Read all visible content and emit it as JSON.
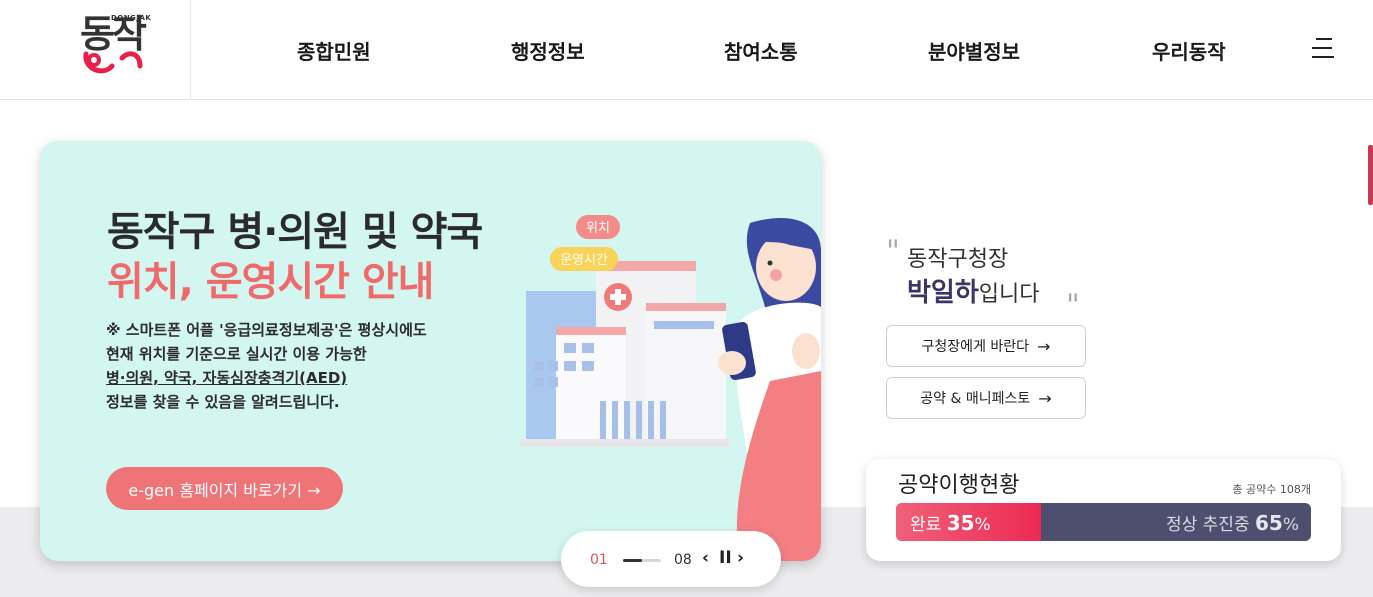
{
  "header": {
    "logo_sub": "DONGJAK",
    "logo_main": "동작",
    "nav": [
      "종합민원",
      "행정정보",
      "참여소통",
      "분야별정보",
      "우리동작"
    ]
  },
  "banner": {
    "title_line1": "동작구 병·의원 및 약국",
    "title_line2": "위치, 운영시간 안내",
    "desc": {
      "l1_prefix": "※ 스마트폰 어플 ",
      "l1_highlight": "'응급의료정보제공'",
      "l1_suffix": "은 평상시에도",
      "l2": "현재 위치를 기준으로 실시간 이용 가능한",
      "l3": "병·의원, 약국, 자동심장충격기(AED)",
      "l4": "정보를 찾을 수 있음을 알려드립니다."
    },
    "button": "e-gen 홈페이지 바로가기 →",
    "bubble_location": "위치",
    "bubble_hours": "운영시간"
  },
  "pager": {
    "current": "01",
    "total": "08",
    "prev": "‹",
    "pause": "II",
    "next": "›",
    "progress": 0.5
  },
  "mayor": {
    "role": "동작구청장",
    "name": "박일하",
    "name_suffix": "입니다",
    "btn_wish": "구청장에게 바란다",
    "btn_pledge": "공약 & 매니페스토",
    "arrow": "→"
  },
  "pledge": {
    "title": "공약이행현황",
    "total": "총 공약수 108개",
    "done_label": "완료",
    "done_value": "35",
    "progress_label": "정상 추진중",
    "progress_value": "65",
    "percent": "%",
    "done_ratio": 0.35
  },
  "colors": {
    "banner_bg": "#d3f6f1",
    "accent_red": "#ef6a6a",
    "mayor_name": "#3a3566",
    "bar_bg": "#4e4e6e"
  }
}
